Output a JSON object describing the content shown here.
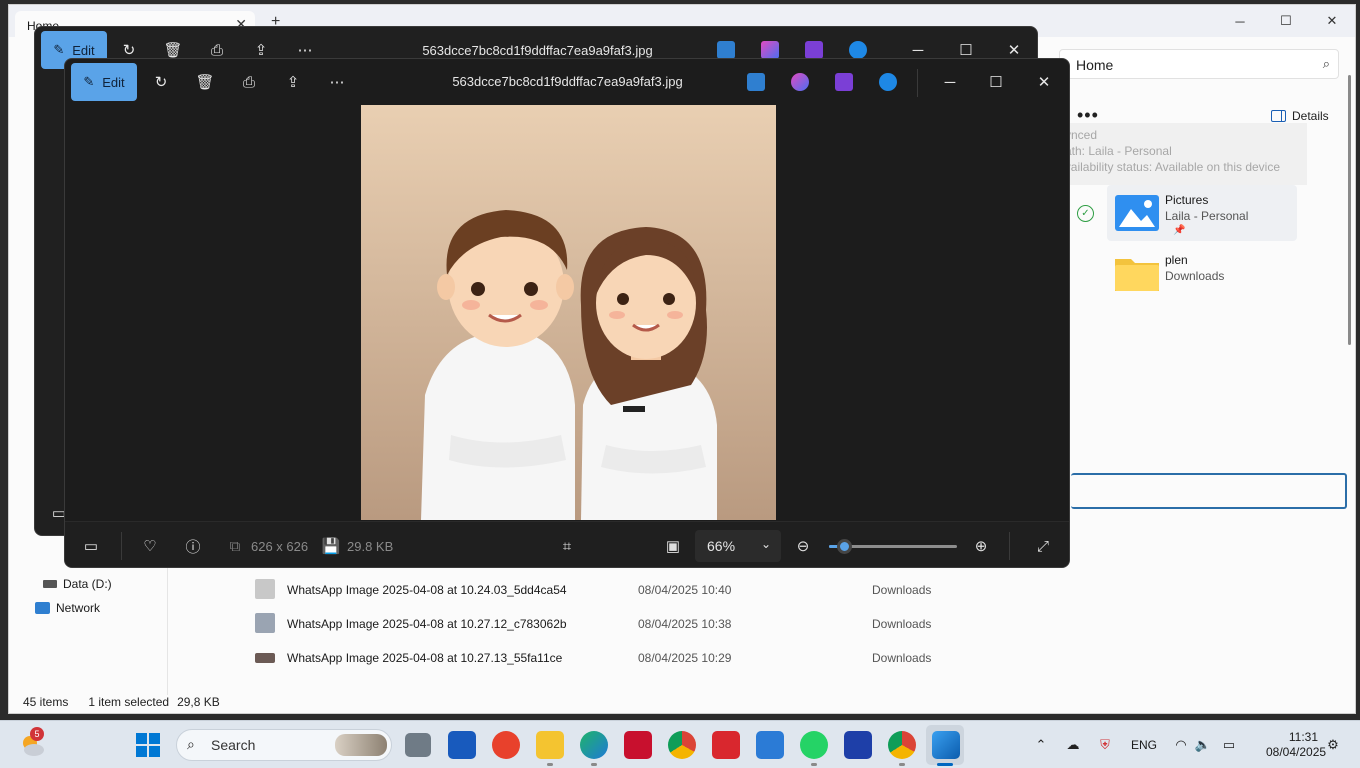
{
  "explorer": {
    "tab_title": "Home",
    "address": "Home",
    "more": "•••",
    "details_label": "Details",
    "tooltip_lines": [
      "Synced",
      "Path: Laila - Personal",
      "Availability status: Available on this device"
    ],
    "quick_access": [
      {
        "name": "Pictures",
        "sub": "Laila - Personal",
        "pinned": "📌"
      },
      {
        "name": "plen",
        "sub": "Downloads",
        "pinned": ""
      }
    ],
    "nav": [
      {
        "label": "Data (D:)"
      },
      {
        "label": "Network"
      }
    ],
    "files": [
      {
        "name": "WhatsApp Image 2025-04-08 at 10.24.03_5dd4ca54",
        "date": "08/04/2025 10:40",
        "location": "Downloads"
      },
      {
        "name": "WhatsApp Image 2025-04-08 at 10.27.12_c783062b",
        "date": "08/04/2025 10:38",
        "location": "Downloads"
      },
      {
        "name": "WhatsApp Image 2025-04-08 at 10.27.13_55fa11ce",
        "date": "08/04/2025 10:29",
        "location": "Downloads"
      }
    ],
    "status": {
      "items": "45 items",
      "selected": "1 item selected",
      "size": "29,8 KB"
    }
  },
  "photos": {
    "edit_label": "Edit",
    "title": "563dcce7bc8cd1f9ddffac7ea9a9faf3.jpg",
    "dimensions": "626 x 626",
    "file_size": "29.8 KB",
    "zoom_label": "66%",
    "zoom_level": 0.12
  },
  "taskbar": {
    "search_placeholder": "Search",
    "weather_badge": "5",
    "language": "ENG",
    "time": "11:31",
    "date": "08/04/2025"
  },
  "colors": {
    "accent": "#5aa3e8",
    "taskbar_bg": "#dfe6ee",
    "photos_bg": "#1c1c1c"
  }
}
